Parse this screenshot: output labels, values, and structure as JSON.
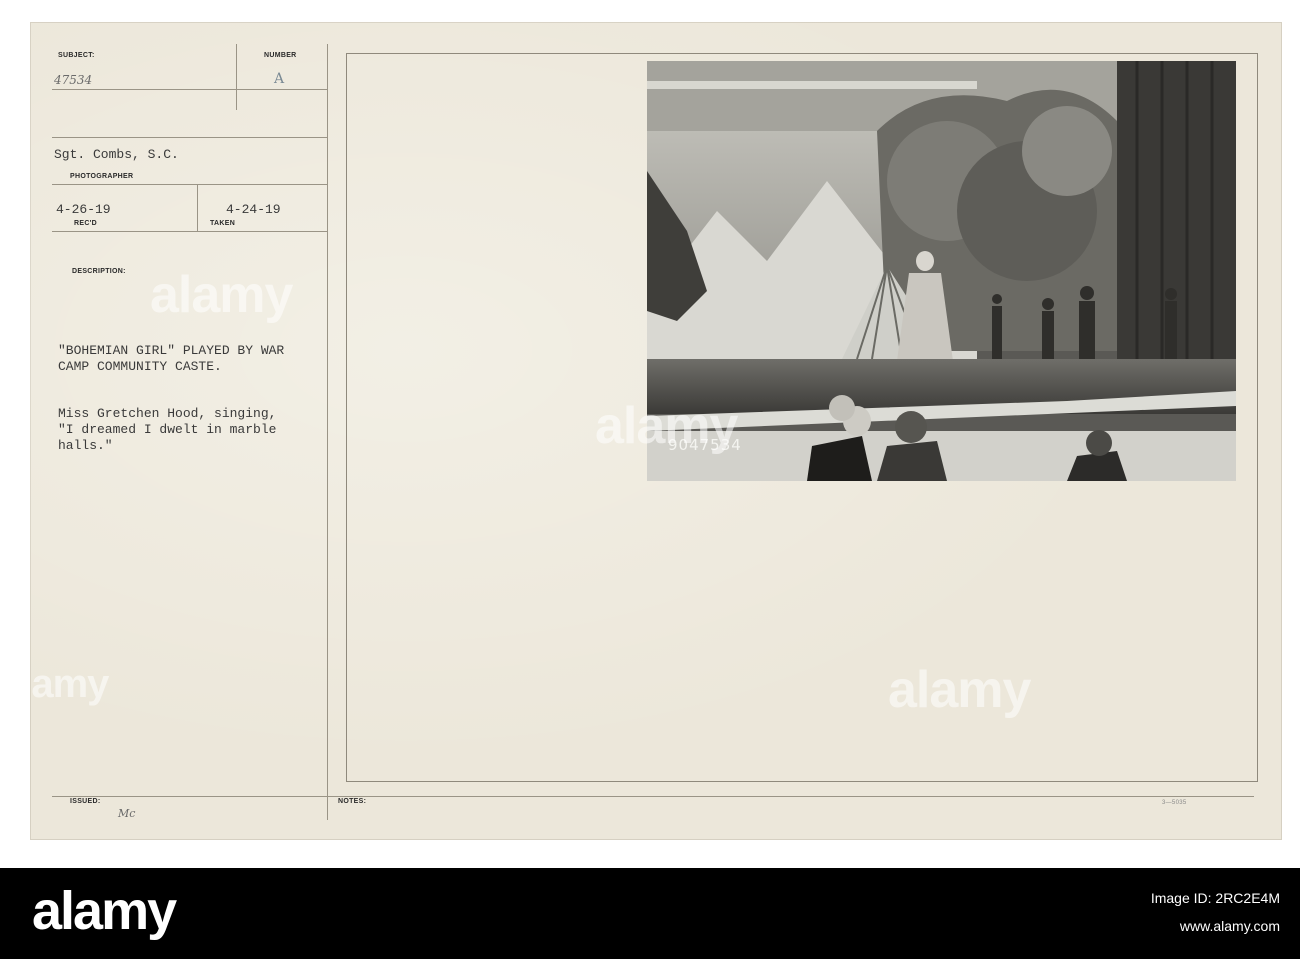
{
  "card": {
    "subject_label": "SUBJECT:",
    "subject_value": "47534",
    "number_label": "NUMBER",
    "number_value": "A",
    "photographer_value": "Sgt. Combs, S.C.",
    "photographer_label": "PHOTOGRAPHER",
    "recd_value": "4-26-19",
    "recd_label": "REC'D",
    "taken_value": "4-24-19",
    "taken_label": "TAKEN",
    "description_label": "DESCRIPTION:",
    "description_line1": "\"BOHEMIAN GIRL\" PLAYED BY WAR",
    "description_line2": "CAMP COMMUNITY CASTE.",
    "caption_line1": "Miss Gretchen Hood, singing,",
    "caption_line2": "\"I dreamed I dwelt in marble",
    "caption_line3": "halls.\"",
    "issued_label": "ISSUED:",
    "issued_value": "Mc",
    "notes_label": "NOTES:",
    "form_code": "3—5035"
  },
  "photo": {
    "negative_number": "9047534"
  },
  "watermark": {
    "text": "alamy"
  },
  "footer": {
    "logo": "alamy",
    "image_id": "Image ID: 2RC2E4M",
    "site": "www.alamy.com"
  }
}
